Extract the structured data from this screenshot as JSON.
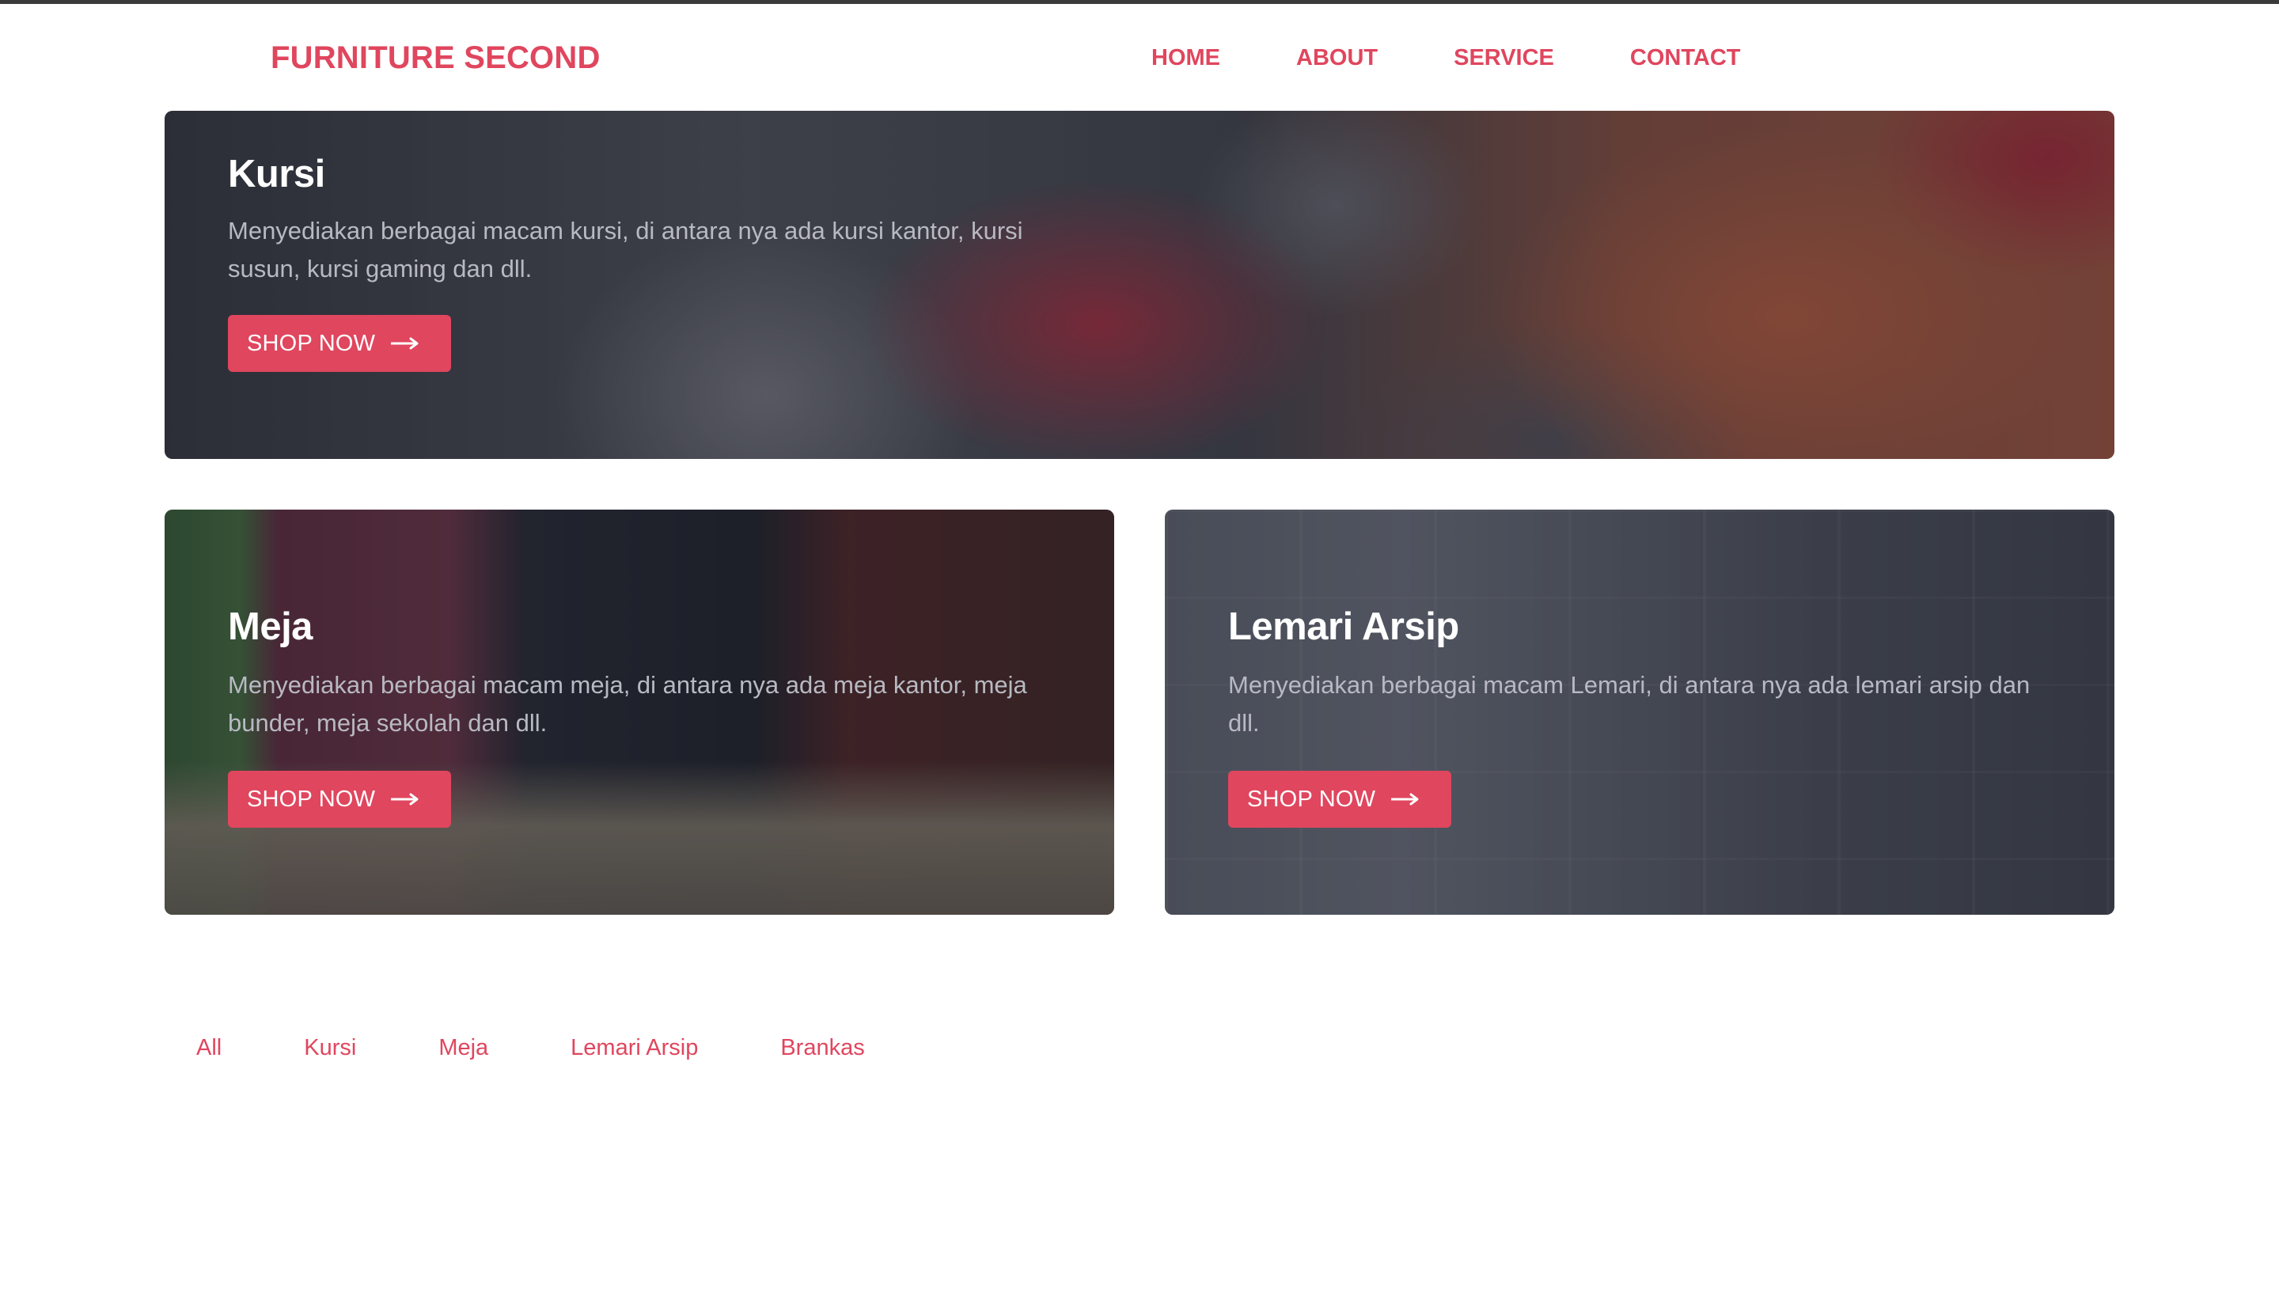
{
  "header": {
    "brand": "FURNITURE SECOND",
    "nav": [
      "HOME",
      "ABOUT",
      "SERVICE",
      "CONTACT"
    ]
  },
  "cards": [
    {
      "title": "Kursi",
      "description": "Menyediakan berbagai macam kursi, di antara nya ada kursi kantor, kursi susun, kursi gaming dan dll.",
      "button": "SHOP NOW"
    },
    {
      "title": "Meja",
      "description": "Menyediakan berbagai macam meja, di antara nya ada meja kantor, meja bunder, meja sekolah dan dll.",
      "button": "SHOP NOW"
    },
    {
      "title": "Lemari Arsip",
      "description": "Menyediakan berbagai macam Lemari, di antara nya ada lemari arsip dan dll.",
      "button": "SHOP NOW"
    }
  ],
  "filters": [
    "All",
    "Kursi",
    "Meja",
    "Lemari Arsip",
    "Brankas"
  ],
  "colors": {
    "accent": "#e0465e",
    "overlay_text": "#b8b9c2"
  },
  "icons": {
    "button_icon": "arrow-right-icon"
  }
}
